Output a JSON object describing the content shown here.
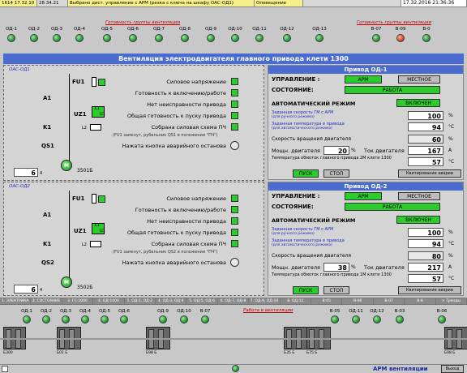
{
  "topbar": {
    "c1": "1614 17.32.10",
    "c2": "28.34.21",
    "c3": "Выбрано дист. управление с АРМ (резка с ключа на шкафу ОАС-ОД1)",
    "c4": "Оповещение",
    "clock": "17.32.2016 21:36:36"
  },
  "captions": {
    "left": "Готовность группы вентиляции",
    "right": "Готовность группы вентиляции"
  },
  "top_lamps": [
    {
      "label": "ОД-1",
      "state": "green"
    },
    {
      "label": "ОД-2",
      "state": "green"
    },
    {
      "label": "ОД-3",
      "state": "green"
    },
    {
      "label": "ОД-4",
      "state": "green"
    },
    {
      "label": "ОД-5",
      "state": "green"
    },
    {
      "label": "ОД-6",
      "state": "green"
    },
    {
      "label": "ОД-7",
      "state": "green"
    },
    {
      "label": "ОД-8",
      "state": "green"
    },
    {
      "label": "ОД-9",
      "state": "green"
    },
    {
      "label": "ОД-10",
      "state": "green"
    },
    {
      "label": "ОД-11",
      "state": "green"
    },
    {
      "label": "ОД-12",
      "state": "green"
    },
    {
      "label": "ОД-13",
      "state": "green"
    },
    {
      "label": "В-07",
      "state": "green"
    },
    {
      "label": "В-09",
      "state": "red"
    },
    {
      "label": "В-0",
      "state": "green"
    }
  ],
  "main_title": "Вентиляция электродвигателя главного привода клети 1300",
  "schematics": [
    {
      "cab": "ОАС-ОД1",
      "fu": "FU1",
      "a": "A1",
      "uz": "UZ1",
      "k": "K1",
      "qs": "QS1",
      "num": "6",
      "num_sub": "4",
      "motor": "3501Б",
      "m": "M",
      "l1": "L1",
      "l2": "L2",
      "u1": "U1",
      "statuses": [
        "Силовое напряжение",
        "Готовность к включению/работе",
        "Нет неисправности привода",
        "Общая готовность к пуску привода",
        "Собрана силовая схема ПЧ"
      ],
      "note": "(FU1 замкнут, рубильник QS1 в положении \"ПЧ\")",
      "estop": "Нажата кнопка аварийного останова"
    },
    {
      "cab": "ОАС-ОД2",
      "fu": "FU1",
      "a": "A1",
      "uz": "UZ1",
      "k": "K1",
      "qs": "QS2",
      "num": "6",
      "num_sub": "4",
      "motor": "3502Б",
      "m": "M",
      "l1": "L1",
      "l2": "L2",
      "u1": "U1",
      "statuses": [
        "Силовое напряжение",
        "Готовность к включению/работе",
        "Нет неисправности привода",
        "Общая готовность к пуску привода",
        "Собрана силовая схема ПЧ"
      ],
      "note": "(FU1 замкнут, рубильник QS2 в положении \"ПЧ\")",
      "estop": "Нажата кнопка аварийного останова"
    }
  ],
  "drives": [
    {
      "title": "Привод ОД-1",
      "control_label": "УПРАВЛЕНИЕ :",
      "arm": "АРМ",
      "local": "МЕСТНОЕ",
      "state_label": "СОСТОЯНИЕ:",
      "state": "РАБОТА",
      "auto_label": "АВТОМАТИЧЕСКИЙ РЕЖИМ",
      "auto_btn": "ВКЛЮЧЕН",
      "sp_speed": "Заданная скорость ГМ с АРМ",
      "sp_speed_sub": "(для ручного режима)",
      "sp_speed_val": "100",
      "sp_speed_unit": "%",
      "sp_temp": "Заданная температура в привода",
      "sp_temp_sub": "(для автоматического режима)",
      "sp_temp_val": "94",
      "sp_temp_unit": "°C",
      "speed_label": "Скорость вращения двигателя",
      "speed_val": "60",
      "speed_unit": "%",
      "power_label": "Мощн. двигателя",
      "power_val": "20",
      "power_unit": "%",
      "current_label": "Ток двигателя",
      "current_val": "167",
      "current_unit": "А",
      "wind_label": "Температура обмоток главного привода 2М клети 1300",
      "wind_val": "57",
      "wind_unit": "°C",
      "start": "ПУСК",
      "stop": "СТОП",
      "reset": "Квитирование аварии"
    },
    {
      "title": "Привод ОД-2",
      "control_label": "УПРАВЛЕНИЕ :",
      "arm": "АРМ",
      "local": "МЕСТНОЕ",
      "state_label": "СОСТОЯНИЕ:",
      "state": "РАБОТА",
      "auto_label": "АВТОМАТИЧЕСКИЙ РЕЖИМ",
      "auto_btn": "ВКЛЮЧЕН",
      "sp_speed": "Заданная скорость ГМ с АРМ",
      "sp_speed_sub": "(для ручного режима)",
      "sp_speed_val": "100",
      "sp_speed_unit": "%",
      "sp_temp": "Заданная температура в привода",
      "sp_temp_sub": "(для автоматического режима)",
      "sp_temp_val": "94",
      "sp_temp_unit": "°C",
      "speed_label": "Скорость вращения двигателя",
      "speed_val": "80",
      "speed_unit": "%",
      "power_label": "Мощн. двигателя",
      "power_val": "38",
      "power_unit": "%",
      "current_label": "Ток двигателя",
      "current_val": "217",
      "current_unit": "А",
      "wind_label": "Температура обмоток главного привода 1М клети 1300",
      "wind_val": "57",
      "wind_unit": "°C",
      "start": "ПУСК",
      "stop": "СТОП",
      "reset": "Квитирование аварии"
    }
  ],
  "tabs": [
    "1. ЭЛЕКТРИКА",
    "2. СОСТОЯНИЕ",
    "3. ГС-1000",
    "4. ОД-1000",
    "5. ОД-1, ОД-2",
    "4. ОД-3, ОД-4",
    "5. ОД-5, ОД-6",
    "6. ОД-7, ОД-8",
    "7. ОД-9, ОД-10",
    "8. ОД-11",
    "В-05",
    "В-06",
    "В-07",
    "В-8",
    "> Тренды"
  ],
  "bottom": {
    "work_caption": "Работа в вентиляции",
    "lamps": [
      "ОД-1",
      "ОД-2",
      "ОД-3",
      "ОД-4",
      "ОД-5",
      "ОД-6",
      "ОД-9",
      "ОД-10",
      "В-07",
      "В-05",
      "ОД-11",
      "ОД-12",
      "В-03",
      "В-06"
    ],
    "cab_labels": [
      "Б300",
      "Б01 Б",
      "Б98 Б",
      "Б35 Б",
      "Б75 Б",
      "Б08 Б"
    ],
    "status": "АРМ вентиляции",
    "btn": "Выход"
  }
}
